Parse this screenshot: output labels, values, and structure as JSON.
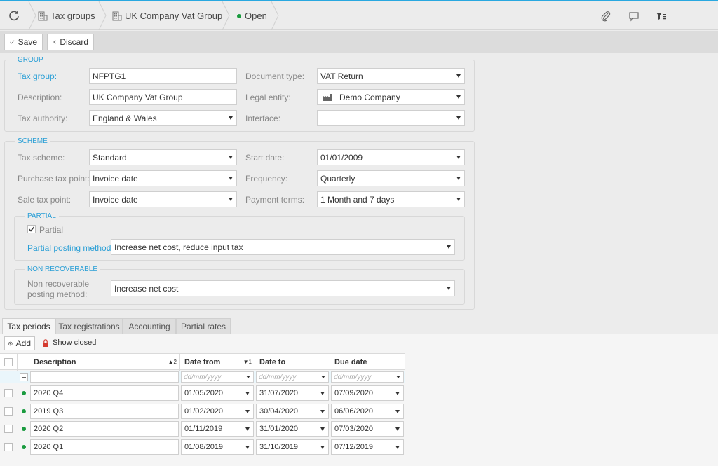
{
  "breadcrumb": {
    "items": [
      {
        "label": "Tax groups"
      },
      {
        "label": "UK Company Vat Group"
      },
      {
        "label": "Open",
        "status_color": "#1a9b3f"
      }
    ]
  },
  "toolbar": {
    "save_label": "Save",
    "discard_label": "Discard"
  },
  "group": {
    "title": "GROUP",
    "tax_group_label": "Tax group:",
    "tax_group_value": "NFPTG1",
    "description_label": "Description:",
    "description_value": "UK Company Vat Group",
    "tax_authority_label": "Tax authority:",
    "tax_authority_value": "England & Wales",
    "document_type_label": "Document type:",
    "document_type_value": "VAT Return",
    "legal_entity_label": "Legal entity:",
    "legal_entity_value": "Demo Company",
    "interface_label": "Interface:",
    "interface_value": ""
  },
  "scheme": {
    "title": "SCHEME",
    "tax_scheme_label": "Tax scheme:",
    "tax_scheme_value": "Standard",
    "purchase_tax_point_label": "Purchase tax point:",
    "purchase_tax_point_value": "Invoice date",
    "sale_tax_point_label": "Sale tax point:",
    "sale_tax_point_value": "Invoice date",
    "start_date_label": "Start date:",
    "start_date_value": "01/01/2009",
    "frequency_label": "Frequency:",
    "frequency_value": "Quarterly",
    "payment_terms_label": "Payment terms:",
    "payment_terms_value": "1 Month and 7 days"
  },
  "partial": {
    "title": "PARTIAL",
    "checkbox_label": "Partial",
    "checked": true,
    "posting_method_label": "Partial posting method:",
    "posting_method_value": "Increase net cost, reduce input tax"
  },
  "non_recoverable": {
    "title": "NON RECOVERABLE",
    "posting_method_label_line1": "Non recoverable",
    "posting_method_label_line2": "posting method:",
    "posting_method_value": "Increase net cost"
  },
  "tabs": [
    {
      "label": "Tax periods",
      "active": true
    },
    {
      "label": "Tax registrations",
      "active": false
    },
    {
      "label": "Accounting",
      "active": false
    },
    {
      "label": "Partial rates",
      "active": false
    }
  ],
  "grid": {
    "add_label": "Add",
    "show_closed_label": "Show closed",
    "columns": [
      {
        "label": "Description",
        "sort": "▲2"
      },
      {
        "label": "Date from",
        "sort": "▼1"
      },
      {
        "label": "Date to",
        "sort": ""
      },
      {
        "label": "Due date",
        "sort": ""
      }
    ],
    "filter_placeholder": "dd/mm/yyyy",
    "rows": [
      {
        "description": "2020 Q4",
        "date_from": "01/05/2020",
        "date_to": "31/07/2020",
        "due_date": "07/09/2020"
      },
      {
        "description": "2019 Q3",
        "date_from": "01/02/2020",
        "date_to": "30/04/2020",
        "due_date": "06/06/2020"
      },
      {
        "description": "2020 Q2",
        "date_from": "01/11/2019",
        "date_to": "31/01/2020",
        "due_date": "07/03/2020"
      },
      {
        "description": "2020 Q1",
        "date_from": "01/08/2019",
        "date_to": "31/10/2019",
        "due_date": "07/12/2019"
      }
    ]
  }
}
